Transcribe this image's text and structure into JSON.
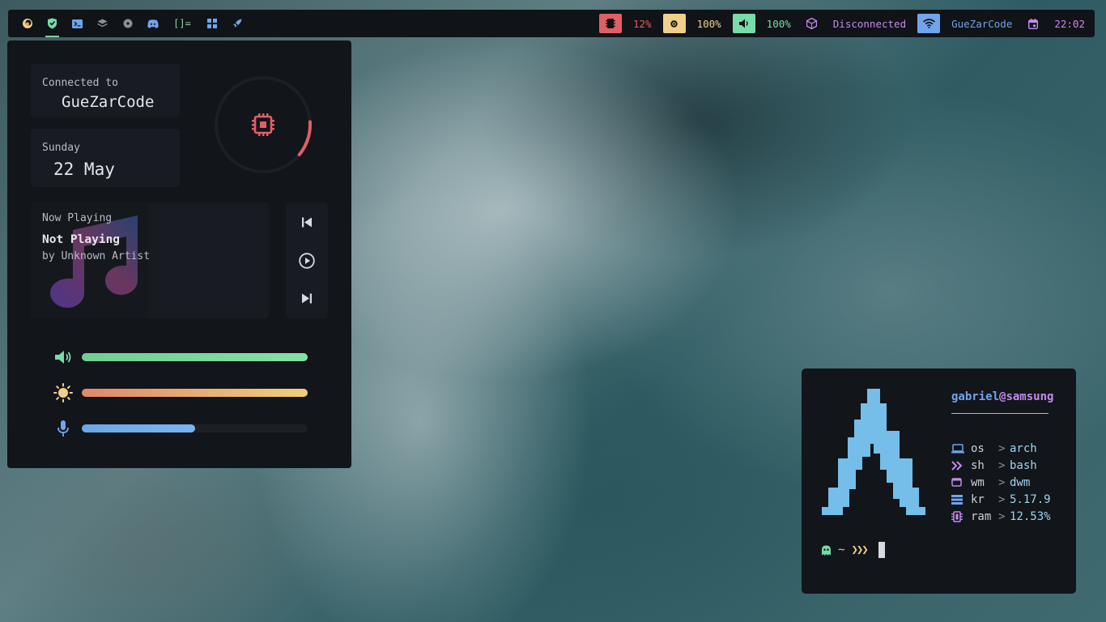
{
  "colors": {
    "bar_bg": "#101317",
    "panel_bg": "#12151a",
    "card_bg": "#181c22",
    "red": "#e05f65",
    "yellow": "#f1cf8a",
    "green": "#78dba9",
    "blue": "#70a5eb",
    "purple": "#c68aee",
    "cyan": "#74bee9"
  },
  "topbar": {
    "workspaces": [
      {
        "icon": "firefox-icon",
        "active": false
      },
      {
        "icon": "shield-icon",
        "active": true
      },
      {
        "icon": "terminal-icon",
        "active": false
      },
      {
        "icon": "layers-icon",
        "active": false
      },
      {
        "icon": "disc-icon",
        "active": false
      },
      {
        "icon": "discord-icon",
        "active": false
      }
    ],
    "layout_symbol": "[]=",
    "status": {
      "cpu": "12%",
      "brightness": "100%",
      "volume": "100%",
      "vpn": "Disconnected",
      "wifi": "GueZarCode",
      "clock": "22:02"
    }
  },
  "control_center": {
    "network": {
      "label": "Connected to",
      "ssid": "GueZarCode"
    },
    "date": {
      "day": "Sunday",
      "date": "22 May"
    },
    "cpu_ring": {
      "usage_fraction": 0.12
    },
    "music": {
      "heading": "Now Playing",
      "title": "Not Playing",
      "artist": "by Unknown Artist"
    },
    "sliders": {
      "volume": 1.0,
      "brightness": 1.0,
      "microphone": 0.5
    }
  },
  "fetch": {
    "user": "gabriel",
    "at": "@",
    "host": "samsung",
    "rows": [
      {
        "icon": "laptop-icon",
        "key": "os",
        "arrow": ">",
        "value": "arch"
      },
      {
        "icon": "chevrons-icon",
        "key": "sh",
        "arrow": ">",
        "value": "bash"
      },
      {
        "icon": "window-icon",
        "key": "wm",
        "arrow": ">",
        "value": "dwm"
      },
      {
        "icon": "kernel-icon",
        "key": "kr",
        "arrow": ">",
        "value": "5.17.9"
      },
      {
        "icon": "memory-icon",
        "key": "ram",
        "arrow": ">",
        "value": "12.53%"
      }
    ],
    "prompt": {
      "path": "~",
      "symbol": "❯❯❯"
    }
  }
}
